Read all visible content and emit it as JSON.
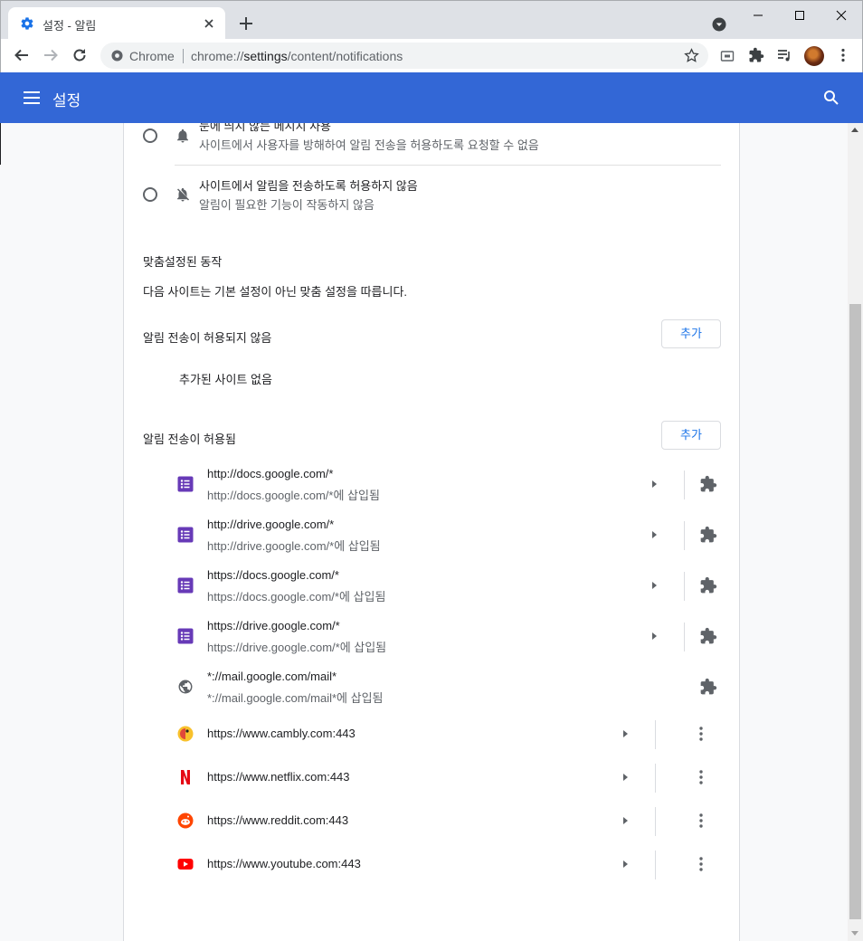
{
  "tab": {
    "title": "설정 - 알림"
  },
  "toolbar": {
    "scheme_label": "Chrome",
    "url_prefix": "chrome://",
    "url_host": "settings",
    "url_path": "/content/notifications"
  },
  "header": {
    "title": "설정"
  },
  "options": [
    {
      "title": "눈에 띄지 않는 메시지 사용",
      "subtitle": "사이트에서 사용자를 방해하여 알림 전송을 허용하도록 요청할 수 없음",
      "icon": "bell-icon"
    },
    {
      "title": "사이트에서 알림을 전송하도록 허용하지 않음",
      "subtitle": "알림이 필요한 기능이 작동하지 않음",
      "icon": "bell-off-icon"
    }
  ],
  "custom": {
    "title": "맞춤설정된 동작",
    "description": "다음 사이트는 기본 설정이 아닌 맞춤 설정을 따릅니다."
  },
  "blocked": {
    "title": "알림 전송이 허용되지 않음",
    "add_label": "추가",
    "empty_text": "추가된 사이트 없음"
  },
  "allowed": {
    "title": "알림 전송이 허용됨",
    "add_label": "추가",
    "sites": [
      {
        "url": "http://docs.google.com/*",
        "sub": "http://docs.google.com/*에 삽입됨",
        "icon": "forms-icon",
        "action": "extension"
      },
      {
        "url": "http://drive.google.com/*",
        "sub": "http://drive.google.com/*에 삽입됨",
        "icon": "forms-icon",
        "action": "extension"
      },
      {
        "url": "https://docs.google.com/*",
        "sub": "https://docs.google.com/*에 삽입됨",
        "icon": "forms-icon",
        "action": "extension"
      },
      {
        "url": "https://drive.google.com/*",
        "sub": "https://drive.google.com/*에 삽입됨",
        "icon": "forms-icon",
        "action": "extension"
      },
      {
        "url": "*://mail.google.com/mail*",
        "sub": "*://mail.google.com/mail*에 삽입됨",
        "icon": "globe-icon",
        "action": "extension"
      },
      {
        "url": "https://www.cambly.com:443",
        "sub": "",
        "icon": "cambly-icon",
        "action": "more"
      },
      {
        "url": "https://www.netflix.com:443",
        "sub": "",
        "icon": "netflix-icon",
        "action": "more"
      },
      {
        "url": "https://www.reddit.com:443",
        "sub": "",
        "icon": "reddit-icon",
        "action": "more"
      },
      {
        "url": "https://www.youtube.com:443",
        "sub": "",
        "icon": "youtube-icon",
        "action": "more"
      }
    ]
  },
  "colors": {
    "accent": "#3367d6",
    "link": "#1a73e8",
    "forms": "#673ab7"
  }
}
